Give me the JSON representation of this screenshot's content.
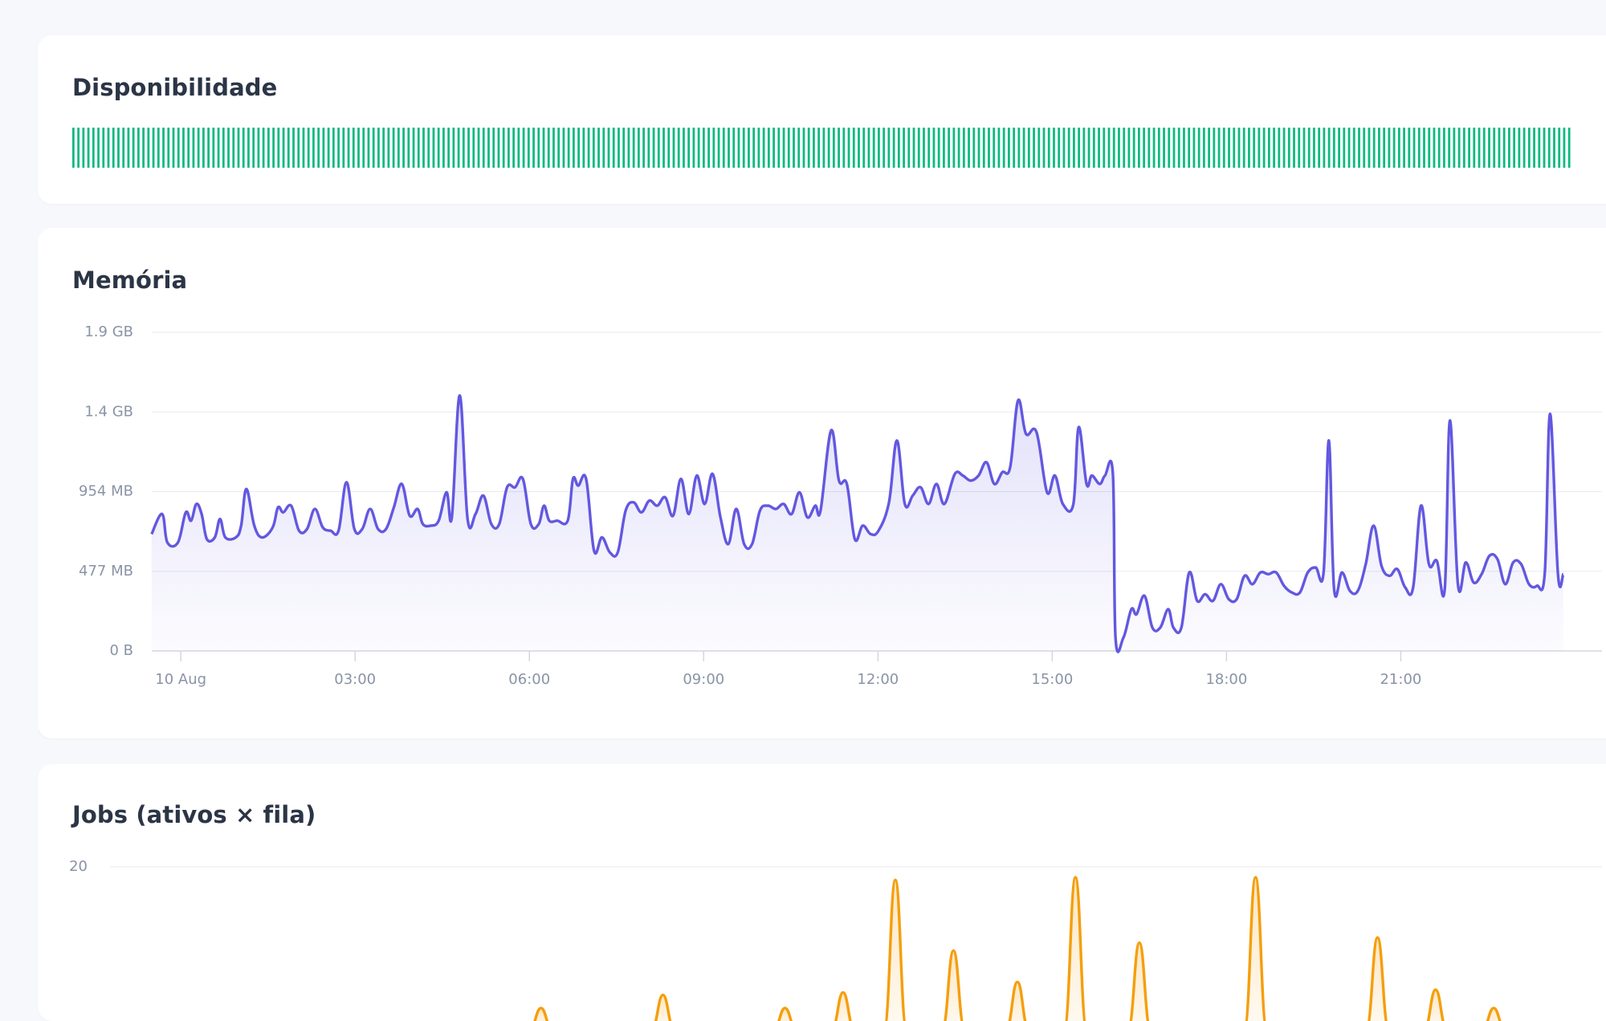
{
  "colors": {
    "availability": "#10b981",
    "memory": "#6358e0",
    "jobs": "#f59e0b",
    "grid": "#e8eaf0",
    "tick_text": "#8a93a6"
  },
  "availability": {
    "title": "Disponibilidade",
    "bar_count": 300,
    "status": "up"
  },
  "memory": {
    "title": "Memória",
    "chart_data": {
      "type": "area",
      "title": "Memória",
      "xlabel": "",
      "ylabel": "",
      "x_ticks": [
        "10 Aug",
        "03:00",
        "06:00",
        "09:00",
        "12:00",
        "15:00",
        "18:00",
        "21:00"
      ],
      "y_ticks": [
        "0 B",
        "477 MB",
        "954 MB",
        "1.4 GB",
        "1.9 GB"
      ],
      "ylim_mb": [
        0,
        1908
      ],
      "xlim_hours": [
        -0.5,
        23.8
      ],
      "grid": true,
      "series": [
        {
          "unit": "MB",
          "points": [
            [
              -0.5,
              700
            ],
            [
              -0.3,
              820
            ],
            [
              -0.2,
              650
            ],
            [
              0.0,
              650
            ],
            [
              0.15,
              830
            ],
            [
              0.25,
              780
            ],
            [
              0.35,
              880
            ],
            [
              0.45,
              820
            ],
            [
              0.55,
              670
            ],
            [
              0.7,
              680
            ],
            [
              0.8,
              790
            ],
            [
              0.9,
              680
            ],
            [
              1.1,
              680
            ],
            [
              1.2,
              750
            ],
            [
              1.3,
              970
            ],
            [
              1.45,
              750
            ],
            [
              1.6,
              680
            ],
            [
              1.8,
              740
            ],
            [
              1.9,
              860
            ],
            [
              2.0,
              830
            ],
            [
              2.15,
              870
            ],
            [
              2.3,
              720
            ],
            [
              2.45,
              730
            ],
            [
              2.6,
              850
            ],
            [
              2.75,
              740
            ],
            [
              2.9,
              720
            ],
            [
              3.05,
              720
            ],
            [
              3.2,
              1010
            ],
            [
              3.35,
              730
            ],
            [
              3.5,
              730
            ],
            [
              3.65,
              850
            ],
            [
              3.8,
              730
            ],
            [
              3.95,
              730
            ],
            [
              4.1,
              860
            ],
            [
              4.25,
              1000
            ],
            [
              4.4,
              810
            ],
            [
              4.55,
              850
            ],
            [
              4.65,
              760
            ],
            [
              4.8,
              750
            ],
            [
              4.95,
              780
            ],
            [
              5.1,
              950
            ],
            [
              5.2,
              800
            ],
            [
              5.35,
              1530
            ],
            [
              5.5,
              790
            ],
            [
              5.65,
              820
            ],
            [
              5.8,
              930
            ],
            [
              5.95,
              760
            ],
            [
              6.1,
              760
            ],
            [
              6.25,
              980
            ],
            [
              6.4,
              980
            ],
            [
              6.55,
              1030
            ],
            [
              6.7,
              760
            ],
            [
              6.85,
              760
            ],
            [
              6.95,
              870
            ],
            [
              7.05,
              780
            ],
            [
              7.2,
              780
            ],
            [
              7.4,
              780
            ],
            [
              7.5,
              1030
            ],
            [
              7.6,
              990
            ],
            [
              7.75,
              1030
            ],
            [
              7.9,
              600
            ],
            [
              8.05,
              680
            ],
            [
              8.2,
              590
            ],
            [
              8.35,
              590
            ],
            [
              8.5,
              840
            ],
            [
              8.65,
              890
            ],
            [
              8.8,
              830
            ],
            [
              8.95,
              900
            ],
            [
              9.1,
              870
            ],
            [
              9.25,
              920
            ],
            [
              9.4,
              810
            ],
            [
              9.55,
              1030
            ],
            [
              9.7,
              820
            ],
            [
              9.85,
              1050
            ],
            [
              10.0,
              880
            ],
            [
              10.15,
              1060
            ],
            [
              10.3,
              800
            ],
            [
              10.45,
              640
            ],
            [
              10.6,
              850
            ],
            [
              10.75,
              640
            ],
            [
              10.9,
              640
            ],
            [
              11.05,
              840
            ],
            [
              11.2,
              870
            ],
            [
              11.35,
              850
            ],
            [
              11.5,
              880
            ],
            [
              11.65,
              820
            ],
            [
              11.8,
              950
            ],
            [
              11.95,
              800
            ],
            [
              12.1,
              870
            ],
            [
              12.2,
              840
            ],
            [
              12.4,
              1320
            ],
            [
              12.55,
              1020
            ],
            [
              12.7,
              1000
            ],
            [
              12.85,
              670
            ],
            [
              13.0,
              750
            ],
            [
              13.15,
              700
            ],
            [
              13.3,
              720
            ],
            [
              13.5,
              890
            ],
            [
              13.65,
              1260
            ],
            [
              13.8,
              880
            ],
            [
              13.95,
              930
            ],
            [
              14.1,
              980
            ],
            [
              14.25,
              880
            ],
            [
              14.4,
              1000
            ],
            [
              14.55,
              880
            ],
            [
              14.75,
              1060
            ],
            [
              14.9,
              1050
            ],
            [
              15.05,
              1020
            ],
            [
              15.2,
              1050
            ],
            [
              15.35,
              1130
            ],
            [
              15.5,
              1000
            ],
            [
              15.65,
              1070
            ],
            [
              15.8,
              1100
            ],
            [
              15.95,
              1500
            ],
            [
              16.1,
              1300
            ],
            [
              16.3,
              1310
            ],
            [
              16.5,
              950
            ],
            [
              16.65,
              1050
            ],
            [
              16.8,
              880
            ],
            [
              17.0,
              880
            ],
            [
              17.1,
              1340
            ],
            [
              17.25,
              1000
            ],
            [
              17.35,
              1050
            ],
            [
              17.5,
              1000
            ],
            [
              17.6,
              1050
            ],
            [
              17.75,
              1060
            ],
            [
              17.8,
              80
            ],
            [
              17.95,
              80
            ],
            [
              18.1,
              250
            ],
            [
              18.2,
              220
            ],
            [
              18.35,
              330
            ],
            [
              18.5,
              140
            ],
            [
              18.65,
              140
            ],
            [
              18.8,
              250
            ],
            [
              18.9,
              140
            ],
            [
              19.05,
              140
            ],
            [
              19.2,
              470
            ],
            [
              19.35,
              300
            ],
            [
              19.5,
              340
            ],
            [
              19.65,
              300
            ],
            [
              19.8,
              400
            ],
            [
              19.95,
              310
            ],
            [
              20.1,
              310
            ],
            [
              20.25,
              450
            ],
            [
              20.4,
              400
            ],
            [
              20.55,
              470
            ],
            [
              20.7,
              460
            ],
            [
              20.85,
              470
            ],
            [
              21.0,
              390
            ],
            [
              21.15,
              350
            ],
            [
              21.3,
              350
            ],
            [
              21.45,
              470
            ],
            [
              21.6,
              500
            ],
            [
              21.75,
              470
            ],
            [
              21.85,
              1260
            ],
            [
              21.95,
              370
            ],
            [
              22.1,
              470
            ],
            [
              22.25,
              360
            ],
            [
              22.4,
              360
            ],
            [
              22.55,
              520
            ],
            [
              22.7,
              750
            ],
            [
              22.85,
              510
            ],
            [
              23.0,
              450
            ],
            [
              23.15,
              490
            ],
            [
              23.3,
              380
            ],
            [
              23.45,
              380
            ],
            [
              23.6,
              870
            ],
            [
              23.75,
              520
            ],
            [
              23.9,
              540
            ],
            [
              24.05,
              370
            ],
            [
              24.15,
              1380
            ],
            [
              24.3,
              400
            ],
            [
              24.45,
              530
            ],
            [
              24.6,
              410
            ],
            [
              24.75,
              460
            ],
            [
              24.9,
              570
            ],
            [
              25.05,
              550
            ],
            [
              25.2,
              400
            ],
            [
              25.35,
              530
            ],
            [
              25.5,
              520
            ],
            [
              25.65,
              400
            ],
            [
              25.8,
              390
            ],
            [
              25.95,
              470
            ],
            [
              26.05,
              1420
            ],
            [
              26.2,
              460
            ],
            [
              26.3,
              460
            ]
          ]
        }
      ]
    }
  },
  "jobs": {
    "title": "Jobs (ativos × fila)",
    "chart_data": {
      "type": "area",
      "title": "Jobs (ativos × fila)",
      "y_ticks": [
        "20"
      ],
      "grid": true,
      "series": [
        {
          "peaks": [
            [
              6.2,
              8
            ],
            [
              8.3,
              13
            ],
            [
              10.4,
              8
            ],
            [
              11.4,
              14
            ],
            [
              12.3,
              57
            ],
            [
              13.3,
              30
            ],
            [
              14.4,
              18
            ],
            [
              15.4,
              58
            ],
            [
              16.5,
              33
            ],
            [
              18.5,
              58
            ],
            [
              20.6,
              35
            ],
            [
              21.6,
              15
            ],
            [
              22.6,
              8
            ]
          ]
        }
      ]
    }
  }
}
